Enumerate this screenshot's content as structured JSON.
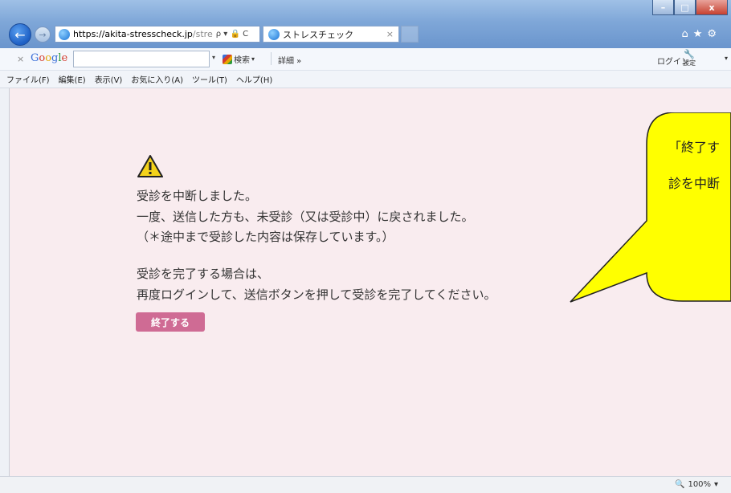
{
  "browser": {
    "address": {
      "host": "https://akita-stresscheck.jp",
      "rest": "/stre",
      "icons": "ρ ▾ 🔒 C"
    },
    "tab_title": "ストレスチェック",
    "tab_close": "×",
    "top_icons": "⌂★⚙"
  },
  "window_controls": {
    "minimize": "–",
    "maximize": "□",
    "close": "x"
  },
  "google_toolbar": {
    "close": "×",
    "logo": [
      "G",
      "o",
      "o",
      "g",
      "l",
      "e"
    ],
    "search_value": "",
    "dropdown": "▾",
    "search_label": "検索",
    "search_drop": "▾",
    "detail_label": "詳細 »",
    "login_label": "ログイン",
    "settings_label": "設定",
    "settings_drop": "▾"
  },
  "menu": [
    "ファイル(F)",
    "編集(E)",
    "表示(V)",
    "お気に入り(A)",
    "ツール(T)",
    "ヘルプ(H)"
  ],
  "content": {
    "lines": [
      "受診を中断しました。",
      "一度、送信した方も、未受診（又は受診中）に戻されました。",
      "（＊途中まで受診した内容は保存しています。）",
      "受診を完了する場合は、",
      "再度ログインして、送信ボタンを押して受診を完了してください。"
    ],
    "end_button": "終了する"
  },
  "callout": {
    "line1": "「終了す",
    "line2": "診を中断"
  },
  "statusbar": {
    "zoom": "100%",
    "zoom_drop": "▾"
  },
  "colors": {
    "content_bg": "#f9ecef",
    "button": "#cf6b94",
    "callout": "#ffff00"
  }
}
